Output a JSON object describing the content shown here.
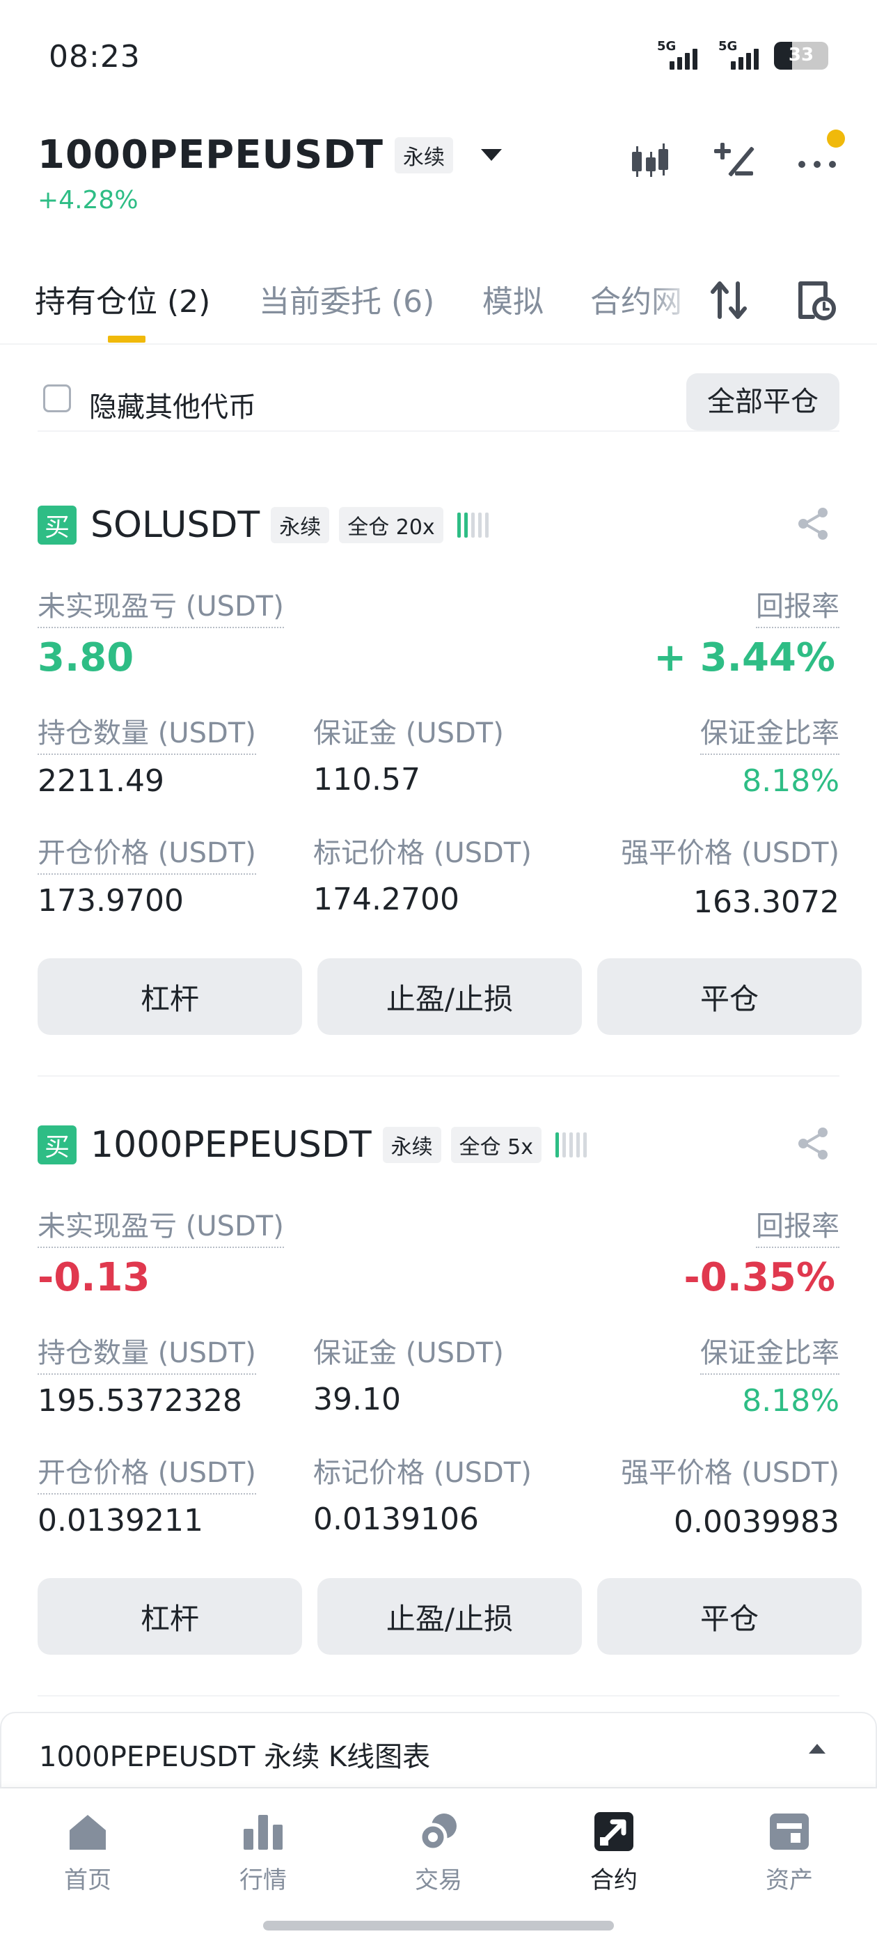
{
  "status_bar": {
    "time": "08:23",
    "signal_1_label": "5G",
    "signal_2_label": "5G",
    "battery_level": 33,
    "battery_text": "33"
  },
  "header": {
    "symbol": "1000PEPEUSDT",
    "contract_tag": "永续",
    "change": "+4.28%",
    "icons": [
      "candlestick-icon",
      "plus-minus-icon",
      "more-icon"
    ]
  },
  "tabs": [
    {
      "label": "持有仓位 (2)",
      "active": true
    },
    {
      "label": "当前委托 (6)",
      "active": false
    },
    {
      "label": "模拟",
      "active": false
    },
    {
      "label": "合约网",
      "active": false
    }
  ],
  "filter": {
    "hide_other_label": "隐藏其他代币",
    "close_all_label": "全部平仓"
  },
  "positions": [
    {
      "side_badge": "买",
      "symbol": "SOLUSDT",
      "contract_tag": "永续",
      "margin_tag": "全仓 20x",
      "pnl_label": "未实现盈亏 (USDT)",
      "pnl": "3.80",
      "roe_label": "回报率",
      "roe": "+ 3.44%",
      "size_label": "持仓数量 (USDT)",
      "size": "2211.49",
      "margin_label": "保证金 (USDT)",
      "margin": "110.57",
      "margin_ratio_label": "保证金比率",
      "margin_ratio": "8.18%",
      "entry_label": "开仓价格 (USDT)",
      "entry_price": "173.9700",
      "mark_label": "标记价格 (USDT)",
      "mark_price": "174.2700",
      "liq_label": "强平价格 (USDT)",
      "liq_price": "163.3072",
      "buttons": {
        "leverage": "杠杆",
        "tpsl": "止盈/止损",
        "close": "平仓"
      }
    },
    {
      "side_badge": "买",
      "symbol": "1000PEPEUSDT",
      "contract_tag": "永续",
      "margin_tag": "全仓 5x",
      "pnl_label": "未实现盈亏 (USDT)",
      "pnl": "-0.13",
      "roe_label": "回报率",
      "roe": "-0.35%",
      "size_label": "持仓数量 (USDT)",
      "size": "195.5372328",
      "margin_label": "保证金 (USDT)",
      "margin": "39.10",
      "margin_ratio_label": "保证金比率",
      "margin_ratio": "8.18%",
      "entry_label": "开仓价格 (USDT)",
      "entry_price": "0.0139211",
      "mark_label": "标记价格 (USDT)",
      "mark_price": "0.0139106",
      "liq_label": "强平价格 (USDT)",
      "liq_price": "0.0039983",
      "buttons": {
        "leverage": "杠杆",
        "tpsl": "止盈/止损",
        "close": "平仓"
      }
    }
  ],
  "chart_bar": {
    "label": "1000PEPEUSDT 永续 K线图表"
  },
  "bottom_nav": [
    {
      "label": "首页",
      "icon": "home-icon",
      "active": false
    },
    {
      "label": "行情",
      "icon": "markets-icon",
      "active": false
    },
    {
      "label": "交易",
      "icon": "trade-icon",
      "active": false
    },
    {
      "label": "合约",
      "icon": "futures-icon",
      "active": true
    },
    {
      "label": "资产",
      "icon": "wallet-icon",
      "active": false
    }
  ],
  "colors": {
    "accent": "#f0b90b",
    "up": "#2ebd85",
    "down": "#e0384e",
    "text": "#1e2329",
    "muted": "#848e9c"
  }
}
